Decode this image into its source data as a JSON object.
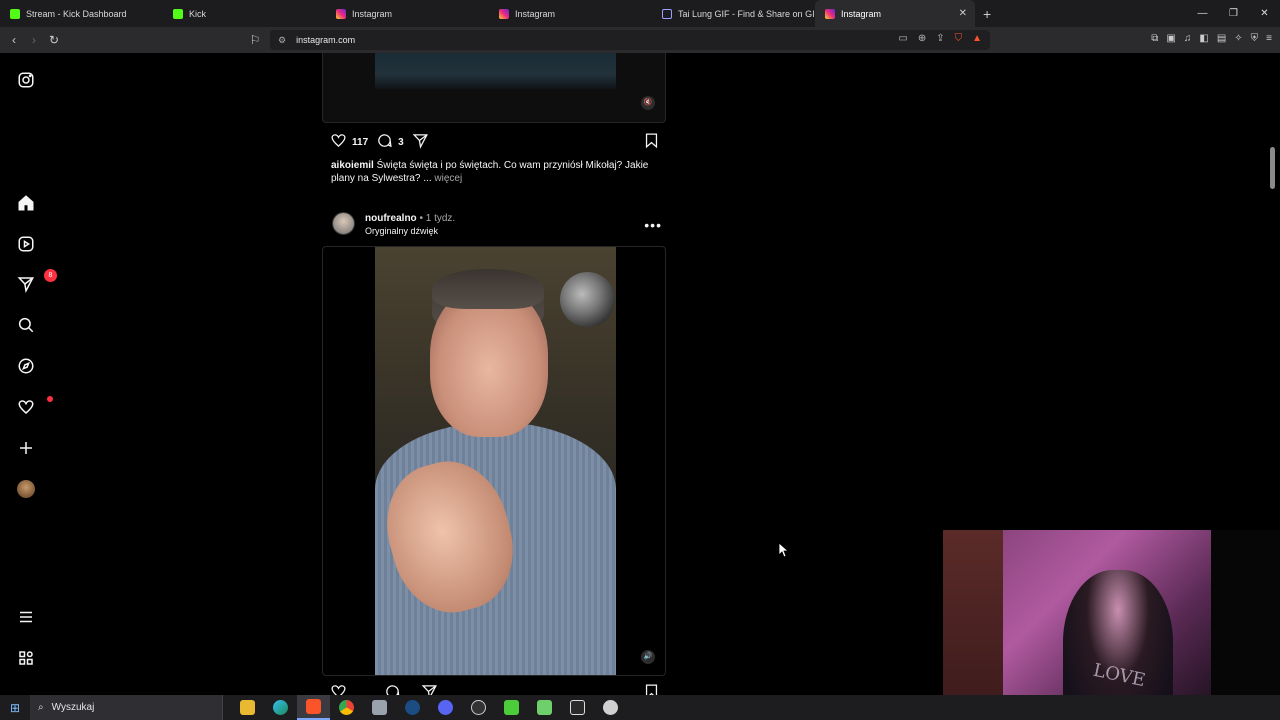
{
  "browser": {
    "tabs": [
      {
        "label": "Stream - Kick Dashboard",
        "icon": "kick-icon"
      },
      {
        "label": "Kick",
        "icon": "kick-icon"
      },
      {
        "label": "Instagram",
        "icon": "instagram-icon"
      },
      {
        "label": "Instagram",
        "icon": "instagram-icon"
      },
      {
        "label": "Tai Lung GIF - Find & Share on GIPHY",
        "icon": "document-icon"
      },
      {
        "label": "Instagram",
        "icon": "instagram-icon",
        "active": true
      }
    ],
    "close_tab": "✕",
    "new_tab": "+",
    "url": "instagram.com"
  },
  "sidebar": {
    "notifications_badge": "8"
  },
  "post1": {
    "likes": "117",
    "comments": "3",
    "caption_user": "aikoiemil",
    "caption_text": " Święta święta i po świętach. Co wam przyniósł Mikołaj? Jakie plany na Sylwestra? ...",
    "caption_more": " więcej"
  },
  "post2": {
    "username": "noufrealno",
    "time": " • 1 tydz.",
    "audio": "Oryginalny dźwięk",
    "menu": "•••"
  },
  "webcam": {
    "shirt_text": "LOVE"
  },
  "taskbar": {
    "search_placeholder": "Wyszukaj"
  },
  "colors": {
    "accent_red": "#ff3040",
    "kick_green": "#53fc18",
    "brave_orange": "#fb542b"
  }
}
